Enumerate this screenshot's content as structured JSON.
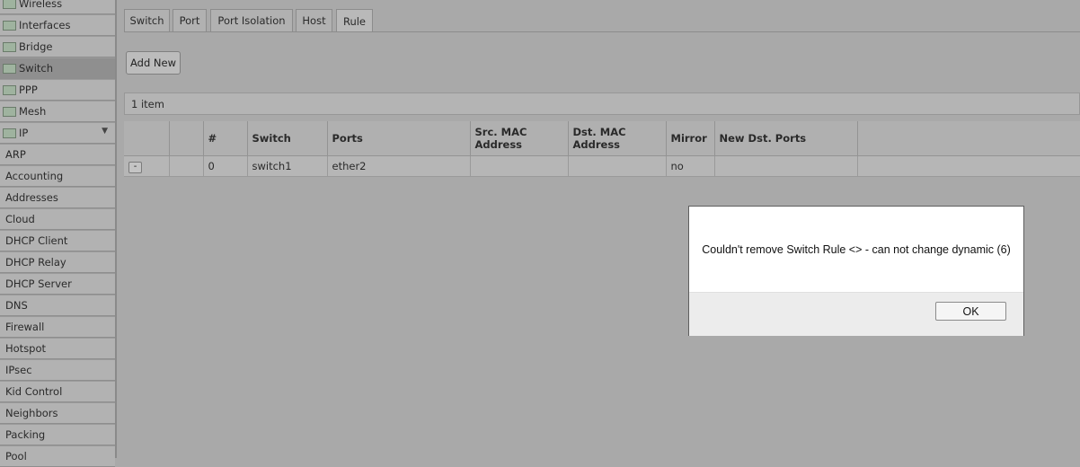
{
  "sidebar": {
    "top_items": [
      {
        "label": "Wireless",
        "icon": "wireless-icon"
      },
      {
        "label": "Interfaces",
        "icon": "interfaces-icon"
      },
      {
        "label": "Bridge",
        "icon": "bridge-icon"
      },
      {
        "label": "Switch",
        "icon": "switch-icon"
      },
      {
        "label": "PPP",
        "icon": "ppp-icon"
      },
      {
        "label": "Mesh",
        "icon": "mesh-icon"
      },
      {
        "label": "IP",
        "icon": "ip-icon"
      }
    ],
    "ip_expand_glyph": "▼",
    "sub_items": [
      "ARP",
      "Accounting",
      "Addresses",
      "Cloud",
      "DHCP Client",
      "DHCP Relay",
      "DHCP Server",
      "DNS",
      "Firewall",
      "Hotspot",
      "IPsec",
      "Kid Control",
      "Neighbors",
      "Packing",
      "Pool"
    ]
  },
  "tabs": [
    "Switch",
    "Port",
    "Port Isolation",
    "Host",
    "Rule"
  ],
  "toolbar": {
    "add_new_label": "Add New"
  },
  "item_count": "1 item",
  "table": {
    "headers": [
      "",
      "",
      "#",
      "Switch",
      "Ports",
      "Src. MAC Address",
      "Dst. MAC Address",
      "Mirror",
      "New Dst. Ports",
      ""
    ],
    "rows": [
      {
        "remove": "-",
        "flag": "",
        "num": "0",
        "switch": "switch1",
        "ports": "ether2",
        "src_mac": "",
        "dst_mac": "",
        "mirror": "no",
        "new_dst_ports": ""
      }
    ]
  },
  "dialog": {
    "message": "Couldn't remove Switch Rule <> - can not change dynamic (6)",
    "ok_label": "OK"
  }
}
